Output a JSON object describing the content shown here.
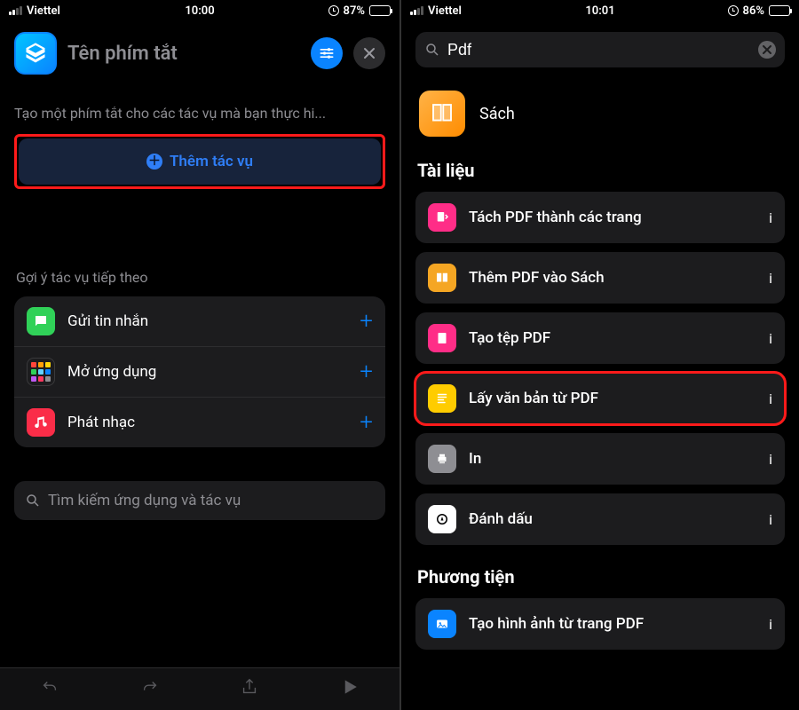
{
  "left": {
    "status": {
      "carrier": "Viettel",
      "time": "10:00",
      "battery_pct": "87%"
    },
    "header": {
      "title": "Tên phím tắt"
    },
    "intro": "Tạo một phím tắt cho các tác vụ mà bạn thực hi...",
    "add_action_label": "Thêm tác vụ",
    "suggestions_title": "Gợi ý tác vụ tiếp theo",
    "suggestions": [
      {
        "label": "Gửi tin nhắn"
      },
      {
        "label": "Mở ứng dụng"
      },
      {
        "label": "Phát nhạc"
      }
    ],
    "search_placeholder": "Tìm kiếm ứng dụng và tác vụ"
  },
  "right": {
    "status": {
      "carrier": "Viettel",
      "time": "10:01",
      "battery_pct": "86%"
    },
    "search_value": "Pdf",
    "app": {
      "label": "Sách"
    },
    "section_docs": "Tài liệu",
    "actions": [
      {
        "label": "Tách PDF thành các trang"
      },
      {
        "label": "Thêm PDF vào Sách"
      },
      {
        "label": "Tạo tệp PDF"
      },
      {
        "label": "Lấy văn bản từ PDF"
      },
      {
        "label": "In"
      },
      {
        "label": "Đánh dấu"
      }
    ],
    "section_media": "Phương tiện",
    "media_actions": [
      {
        "label": "Tạo hình ảnh từ trang PDF"
      }
    ]
  }
}
